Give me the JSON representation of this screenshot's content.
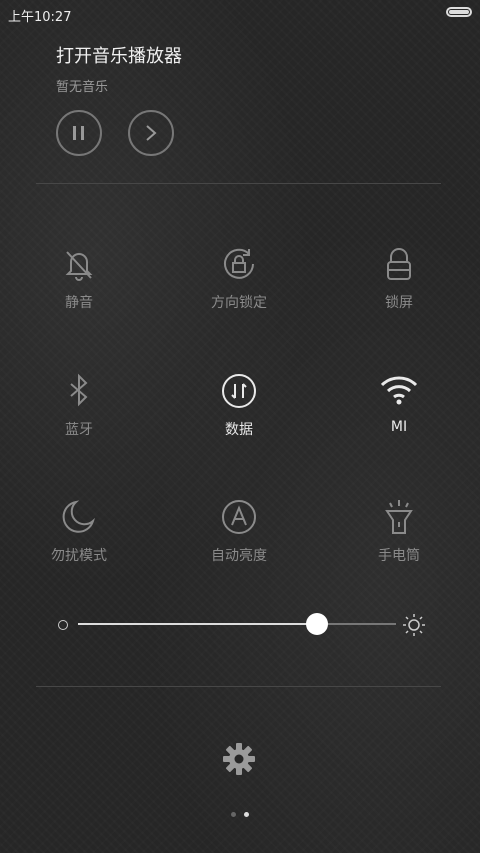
{
  "status_bar": {
    "time": "上午10:27"
  },
  "music": {
    "title": "打开音乐播放器",
    "subtitle": "暂无音乐"
  },
  "toggles": [
    {
      "label": "静音",
      "icon": "bell-mute-icon",
      "active": false
    },
    {
      "label": "方向锁定",
      "icon": "rotation-lock-icon",
      "active": false
    },
    {
      "label": "锁屏",
      "icon": "lock-icon",
      "active": false
    },
    {
      "label": "蓝牙",
      "icon": "bluetooth-icon",
      "active": false
    },
    {
      "label": "数据",
      "icon": "mobile-data-icon",
      "active": true
    },
    {
      "label": "MI",
      "icon": "wifi-icon",
      "active": true
    },
    {
      "label": "勿扰模式",
      "icon": "moon-icon",
      "active": false
    },
    {
      "label": "自动亮度",
      "icon": "auto-brightness-icon",
      "active": false
    },
    {
      "label": "手电筒",
      "icon": "flashlight-icon",
      "active": false
    }
  ],
  "brightness": {
    "level": 0.75
  },
  "pager": {
    "pages": 2,
    "current": 2
  },
  "colors": {
    "active": "#e9e9e9",
    "inactive": "#8a8a8a"
  }
}
